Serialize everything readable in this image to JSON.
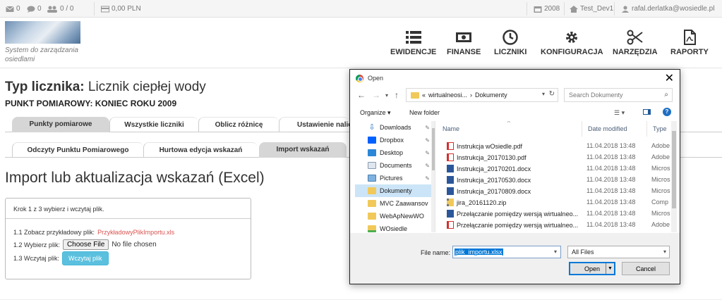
{
  "topbar": {
    "mail_count": "0",
    "chat_count": "0",
    "users_count": "0 / 0",
    "balance": "0,00 PLN",
    "year": "2008",
    "database": "Test_Dev1",
    "user_email": "rafal.derlatka@wosiedle.pl"
  },
  "logo": {
    "subtitle": "System do zarządzania osiedlami"
  },
  "nav": {
    "items": [
      {
        "label": "EWIDENCJE",
        "icon": "list-icon"
      },
      {
        "label": "FINANSE",
        "icon": "money-icon"
      },
      {
        "label": "LICZNIKI",
        "icon": "clock-icon"
      },
      {
        "label": "KONFIGURACJA",
        "icon": "gear-icon"
      },
      {
        "label": "NARZĘDZIA",
        "icon": "scissors-icon"
      },
      {
        "label": "RAPORTY",
        "icon": "pdf-file-icon"
      }
    ]
  },
  "page": {
    "title_prefix": "Typ licznika:",
    "title_value": "Licznik ciepłej wody",
    "point": "PUNKT POMIAROWY: KONIEC ROKU 2009",
    "tabs1": [
      "Punkty pomiarowe",
      "Wszystkie liczniki",
      "Oblicz różnicę",
      "Ustawienie nalic"
    ],
    "tabs2": [
      "Odczyty Punktu Pomiarowego",
      "Hurtowa edycja wskazań",
      "Import wskazań"
    ],
    "section_title": "Import lub aktualizacja wskazań (Excel)"
  },
  "import_box": {
    "header": "Krok 1 z 3 wybierz i wczytaj plik.",
    "step1_label": "1.1 Zobacz przykładowy plik:",
    "step1_link": "PrzykładowyPlikImportu.xls",
    "step2_label": "1.2 Wybierz plik:",
    "choose_file": "Choose File",
    "no_file": "No file chosen",
    "step3_label": "1.3 Wczytaj plik:",
    "upload_button": "Wczytaj plik"
  },
  "dialog": {
    "title": "Open",
    "path_prefix": "«",
    "path_parent": "wirtualneosi...",
    "path_sep": "›",
    "path_current": "Dokumenty",
    "search_placeholder": "Search Dokumenty",
    "organize": "Organize ▾",
    "new_folder": "New folder",
    "nav_items": [
      {
        "label": "Downloads",
        "icon": "download-icon",
        "pinned": true
      },
      {
        "label": "Dropbox",
        "icon": "dropbox-icon",
        "pinned": true
      },
      {
        "label": "Desktop",
        "icon": "desktop-icon",
        "pinned": true
      },
      {
        "label": "Documents",
        "icon": "documents-icon",
        "pinned": true
      },
      {
        "label": "Pictures",
        "icon": "pictures-icon",
        "pinned": true
      },
      {
        "label": "Dokumenty",
        "icon": "folder-icon",
        "pinned": false,
        "selected": true
      },
      {
        "label": "MVC Zaawansov",
        "icon": "folder-icon",
        "pinned": false
      },
      {
        "label": "WebApNewWO",
        "icon": "folder-icon",
        "pinned": false
      },
      {
        "label": "WOsiedle",
        "icon": "folder-icon",
        "pinned": false
      }
    ],
    "columns": [
      "Name",
      "Date modified",
      "Type"
    ],
    "files": [
      {
        "name": "Instrukcja wOsiedle.pdf",
        "date": "11.04.2018 13:48",
        "type": "Adobe",
        "kind": "pdf"
      },
      {
        "name": "Instrukcja_20170130.pdf",
        "date": "11.04.2018 13:48",
        "type": "Adobe",
        "kind": "pdf"
      },
      {
        "name": "Instrukcja_20170201.docx",
        "date": "11.04.2018 13:48",
        "type": "Micros",
        "kind": "docx"
      },
      {
        "name": "Instrukcja_20170530.docx",
        "date": "11.04.2018 13:48",
        "type": "Micros",
        "kind": "docx"
      },
      {
        "name": "Instrukcja_20170809.docx",
        "date": "11.04.2018 13:48",
        "type": "Micros",
        "kind": "docx"
      },
      {
        "name": "jira_20161120.zip",
        "date": "11.04.2018 13:48",
        "type": "Comp",
        "kind": "zip"
      },
      {
        "name": "Przełączanie pomiędzy wersją wirtualneo...",
        "date": "11.04.2018 13:48",
        "type": "Micros",
        "kind": "docx"
      },
      {
        "name": "Przełączanie pomiędzy wersją wirtualneo...",
        "date": "11.04.2018 13:48",
        "type": "Adobe",
        "kind": "pdf"
      }
    ],
    "file_name_label": "File name:",
    "file_name_value": "plik_importu.xlsx",
    "filter": "All Files",
    "open_button": "Open",
    "cancel_button": "Cancel"
  },
  "colors": {
    "accent_blue": "#0078d7",
    "link_red": "#d9534f",
    "upload_button": "#5bc0de",
    "selected_row": "#cce4f7"
  }
}
